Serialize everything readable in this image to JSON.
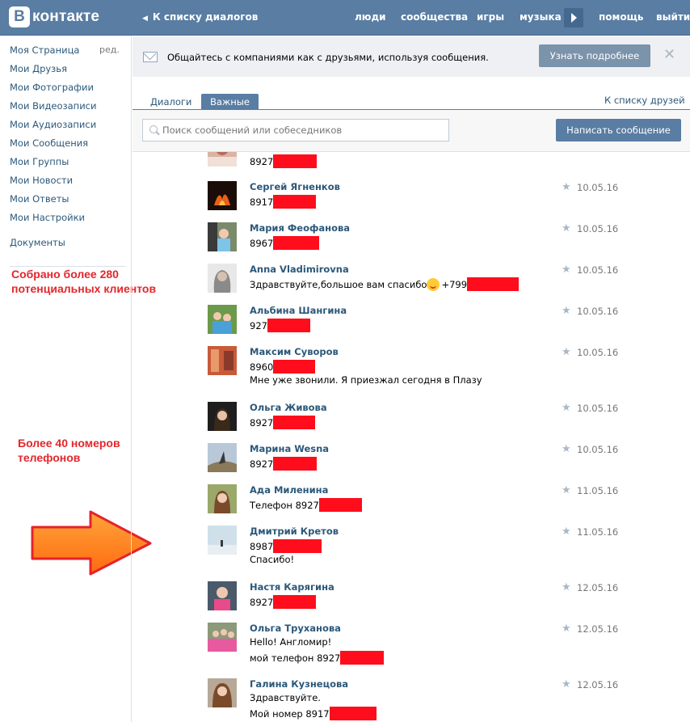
{
  "header": {
    "logo_letter": "В",
    "logo_text": "контакте",
    "back_link": "К списку диалогов",
    "nav": [
      "люди",
      "сообщества",
      "игры",
      "музыка",
      "помощь",
      "выйти"
    ]
  },
  "sidebar": {
    "edit": "ред.",
    "items": [
      "Моя Страница",
      "Мои Друзья",
      "Мои Фотографии",
      "Мои Видеозаписи",
      "Мои Аудиозаписи",
      "Мои Сообщения",
      "Мои Группы",
      "Мои Новости",
      "Мои Ответы",
      "Мои Настройки"
    ],
    "docs": "Документы"
  },
  "annotations": {
    "clients_line1": "Собрано более 280",
    "clients_line2": "потенциальных клиентов",
    "phones_line1": "Более 40 номеров",
    "phones_line2": "телефонов"
  },
  "promo": {
    "text": "Общайтесь с компаниями как с друзьями, используя сообщения.",
    "button": "Узнать подробнее",
    "close": "✕"
  },
  "tabs": [
    "Диалоги",
    "Важные"
  ],
  "friends_link": "К списку друзей",
  "search": {
    "placeholder": "Поиск сообщений или собеседников",
    "write_button": "Написать сообщение"
  },
  "messages": [
    {
      "name": "",
      "lines": [
        "8927"
      ],
      "date": ""
    },
    {
      "name": "Сергей Ягненков",
      "lines": [
        "8917"
      ],
      "date": "10.05.16"
    },
    {
      "name": "Мария Феофанова",
      "lines": [
        "8967"
      ],
      "date": "10.05.16"
    },
    {
      "name": "Anna Vladimirovna",
      "lines": [
        "Здравствуйте,большое вам спасибо",
        "+799"
      ],
      "date": "10.05.16"
    },
    {
      "name": "Альбина Шангина",
      "lines": [
        "927"
      ],
      "date": "10.05.16"
    },
    {
      "name": "Максим Суворов",
      "lines": [
        "8960",
        "Мне уже звонили. Я приезжал сегодня в Плазу"
      ],
      "date": "10.05.16"
    },
    {
      "name": "Ольга Живова",
      "lines": [
        "8927"
      ],
      "date": "10.05.16"
    },
    {
      "name": "Марина Wesna",
      "lines": [
        "8927"
      ],
      "date": "10.05.16"
    },
    {
      "name": "Ада Миленина",
      "lines": [
        "Телефон 8927"
      ],
      "date": "11.05.16"
    },
    {
      "name": "Дмитрий Кретов",
      "lines": [
        "8987",
        "Спасибо!"
      ],
      "date": "11.05.16"
    },
    {
      "name": "Настя Карягина",
      "lines": [
        "8927"
      ],
      "date": "12.05.16"
    },
    {
      "name": "Ольга Труханова",
      "lines": [
        "Hello! Англомир!",
        "мой телефон 8927"
      ],
      "date": "12.05.16"
    },
    {
      "name": "Галина Кузнецова",
      "lines": [
        "Здравствуйте.",
        "Мой номер 8917"
      ],
      "date": "12.05.16"
    }
  ],
  "colors": {
    "header": "#597da3",
    "link": "#2b587a",
    "redaction": "#ff0d1c",
    "annotation": "#e3262b",
    "arrow": "#ff7a1a"
  }
}
